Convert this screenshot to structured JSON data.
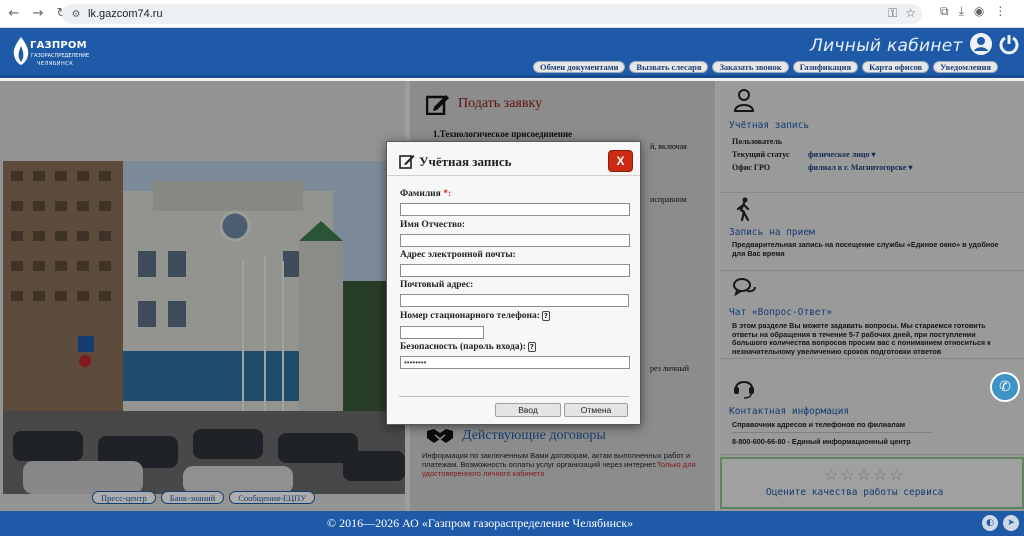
{
  "browser": {
    "url": "lk.gazcom74.ru",
    "back_glyph": "←",
    "forward_glyph": "→",
    "reload_glyph": "↻",
    "site_glyph": "⚙",
    "key_glyph": "⚿",
    "star_glyph": "☆",
    "extensions_glyph": "⧉",
    "download_glyph": "⤓",
    "profile_glyph": "◉",
    "menu_glyph": "⋮"
  },
  "header": {
    "logo": {
      "name": "ГАЗПРОМ",
      "line1": "ГАЗОРАСПРЕДЕЛЕНИЕ",
      "line2": "ЧЕЛЯБИНСК"
    },
    "cabinet_title": "Личный кабинет",
    "nav": [
      "Обмен документами",
      "Вызвать слесаря",
      "Заказать звонок",
      "Газификация",
      "Карта офисов",
      "Уведомления"
    ]
  },
  "left": {
    "bottom_links": [
      "Пресс-центр",
      "Банк-знаний",
      "Сообщения-ЕЦПУ"
    ]
  },
  "middle": {
    "submit_title": "Подать заявку",
    "item1": "1.Технологическое присоединение",
    "frag1": "й, включая",
    "frag2": "исправном",
    "frag3": "рез личный",
    "contracts_title": "Действующие договоры",
    "contracts_text": "Информация по заключенным Вами договорам, актам выполненных работ и платежам. Возможность оплаты услуг организаций через интернет.",
    "contracts_note": "Только для удостоверенного личного кабинета"
  },
  "right": {
    "account": {
      "title": "Учётная запись",
      "rows": [
        {
          "k": "Пользователь",
          "v": ""
        },
        {
          "k": "Текущий статус",
          "v": "физическое лицо ▾"
        },
        {
          "k": "Офис ГРО",
          "v": "филиал в г. Магнитогорске ▾"
        }
      ]
    },
    "appointment": {
      "title": "Запись на прием",
      "text": "Предварительная запись на посещение службы «Единое окно» в удобное для Вас время"
    },
    "qa": {
      "title": "Чат «Вопрос-Ответ»",
      "text": "В этом разделе Вы можете задавать вопросы. Мы стараемся готовить ответы на обращения в течение 5-7 рабочих дней, при поступлении большого количества вопросов просим вас с пониманием относиться к незначительному увеличению сроков подготовки ответов"
    },
    "contacts": {
      "title": "Контактная информация",
      "line1": "Справочник адресов и телефонов по филиалам",
      "line2": "8-800-600-66-80 - Единый информационный центр"
    },
    "rating": {
      "stars": 0,
      "max": 5,
      "label": "Оцените качества работы сервиса"
    }
  },
  "footer": {
    "copyright": "© 2016—2026 АО «Газпром газораспределение Челябинск»"
  },
  "modal": {
    "title": "Учётная запись",
    "close_label": "X",
    "fields": [
      {
        "label": "Фамилия",
        "required": "*:",
        "value": "",
        "help": false
      },
      {
        "label": "Имя Отчество:",
        "required": "",
        "value": "",
        "help": false
      },
      {
        "label": "Адрес электронной почты:",
        "required": "",
        "value": "",
        "help": false
      },
      {
        "label": "Почтовый адрес:",
        "required": "",
        "value": "",
        "help": false
      },
      {
        "label": "Номер стационарного телефона:",
        "required": "",
        "value": "",
        "help": true
      },
      {
        "label": "Безопасность (пароль входа):",
        "required": "",
        "value": "••••••••",
        "help": true
      }
    ],
    "help_glyph": "?",
    "login_label": "Ввод",
    "cancel_label": "Отмена"
  },
  "colors": {
    "brand": "#1e5aa8",
    "accent_red": "#cc2a12",
    "title_red": "#8b1a1a"
  }
}
